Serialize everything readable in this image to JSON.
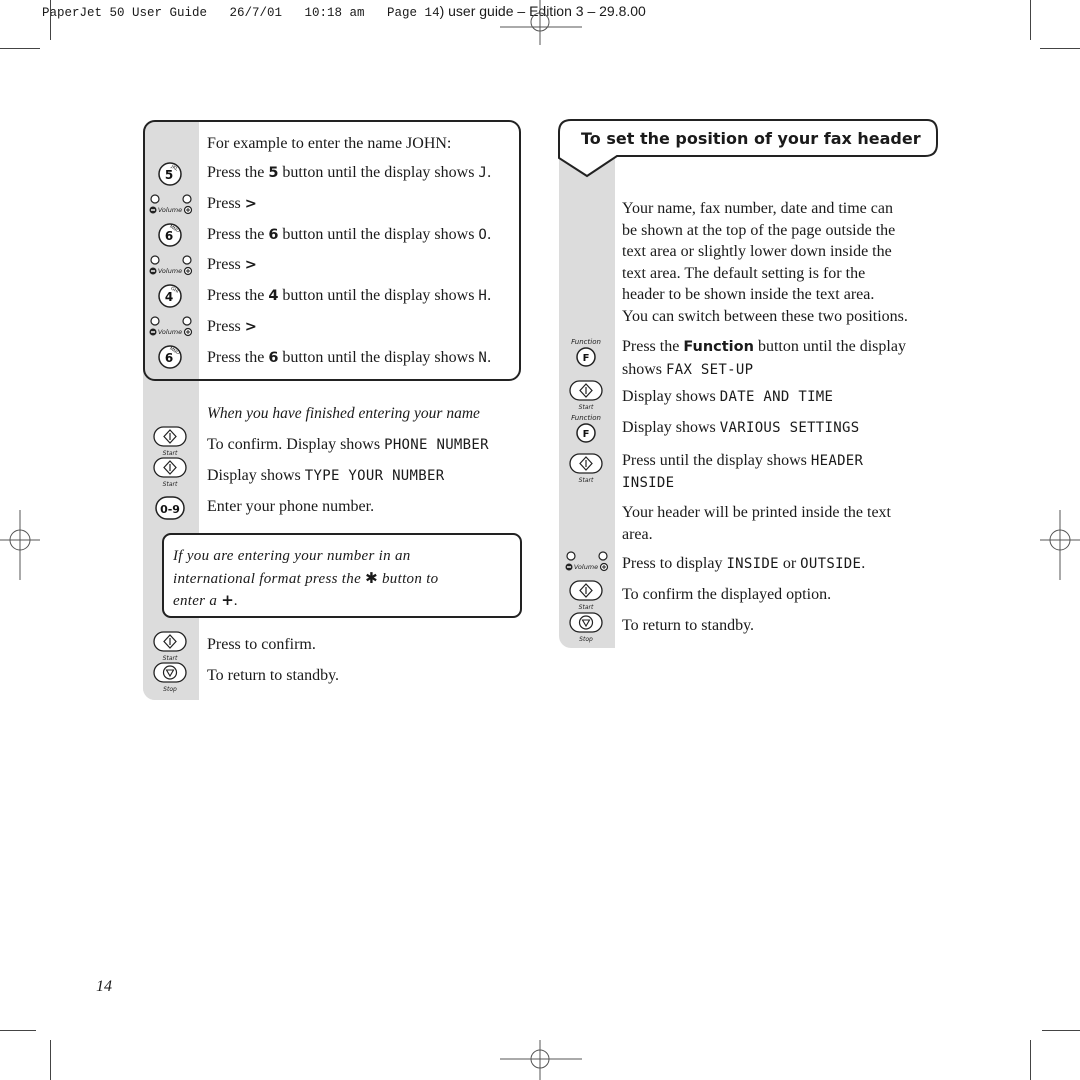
{
  "slug": {
    "meta": "PaperJet 50 User Guide   26/7/01   10:18 am   Page 14",
    "edition": ") user guide – Edition 3 – 29.8.00"
  },
  "left": {
    "intro": "For example to enter the name JOHN:",
    "steps": [
      {
        "icon": "key-5",
        "key_num": "5",
        "key_letters": "JKL",
        "pre": "Press the ",
        "bold": "5",
        "post": " button until the display shows ",
        "lcd": "J",
        "end": "."
      },
      {
        "icon": "volume-buttons",
        "pre": "Press ",
        "bold": ">"
      },
      {
        "icon": "key-6",
        "key_num": "6",
        "key_letters": "MNO",
        "pre": "Press the ",
        "bold": "6",
        "post": " button until the display shows ",
        "lcd": "O",
        "end": "."
      },
      {
        "icon": "volume-buttons",
        "pre": "Press ",
        "bold": ">"
      },
      {
        "icon": "key-4",
        "key_num": "4",
        "key_letters": "GHI",
        "pre": "Press the ",
        "bold": "4",
        "post": " button until the display shows ",
        "lcd": "H",
        "end": "."
      },
      {
        "icon": "volume-buttons",
        "pre": "Press ",
        "bold": ">"
      },
      {
        "icon": "key-6",
        "key_num": "6",
        "key_letters": "MNO",
        "pre": "Press the ",
        "bold": "6",
        "post": " button until the display shows ",
        "lcd": "N",
        "end": "."
      }
    ],
    "finished_heading": "When you have finished entering your name",
    "after_steps": [
      {
        "icon": "start-button",
        "text": "To confirm. Display shows ",
        "lcd": "PHONE NUMBER"
      },
      {
        "icon": "start-button",
        "text": "Display shows ",
        "lcd": "TYPE YOUR NUMBER"
      },
      {
        "icon": "digits-button",
        "key_label": "0-9",
        "text": "Enter your phone number."
      }
    ],
    "note": {
      "line1": "If you are entering your number in an",
      "line2_pre": "international format press the ",
      "star": "✱",
      "line2_post": " button to",
      "line3_pre": "enter a ",
      "plus": "+",
      "line3_post": "."
    },
    "final_steps": [
      {
        "icon": "start-button",
        "text": "Press to confirm."
      },
      {
        "icon": "stop-button",
        "text": "To return to standby."
      }
    ],
    "icon_labels": {
      "volume": "Volume",
      "start": "Start",
      "stop": "Stop"
    }
  },
  "right": {
    "heading": "To set the position of your fax header",
    "intro_lines": [
      "Your name, fax number, date and time can",
      "be shown at the top of the page outside the",
      "text area or slightly lower down inside the",
      "text area. The default setting is for the",
      "header to be shown inside the text area.",
      "You can switch between these two positions."
    ],
    "step1": {
      "pre": "Press the ",
      "bold": "Function",
      "post": " button until the display",
      "line2": "shows ",
      "lcd": "FAX SET-UP"
    },
    "step2": {
      "text": "Display shows ",
      "lcd": "DATE AND TIME"
    },
    "step3": {
      "text": "Display shows ",
      "lcd": "VARIOUS SETTINGS"
    },
    "step4": {
      "text": "Press until the display shows ",
      "lcd1": "HEADER",
      "lcd2": "INSIDE"
    },
    "step5": {
      "line1": "Your header will be printed inside the text",
      "line2": "area."
    },
    "step6": {
      "text": "Press to display ",
      "lcd1": "INSIDE",
      "mid": " or ",
      "lcd2": "OUTSIDE",
      "end": "."
    },
    "step7": {
      "text": "To confirm the displayed option."
    },
    "step8": {
      "text": "To return to standby."
    },
    "icon_labels": {
      "function": "Function",
      "function_key": "F",
      "volume": "Volume",
      "start": "Start",
      "stop": "Stop"
    }
  },
  "page_number": "14"
}
